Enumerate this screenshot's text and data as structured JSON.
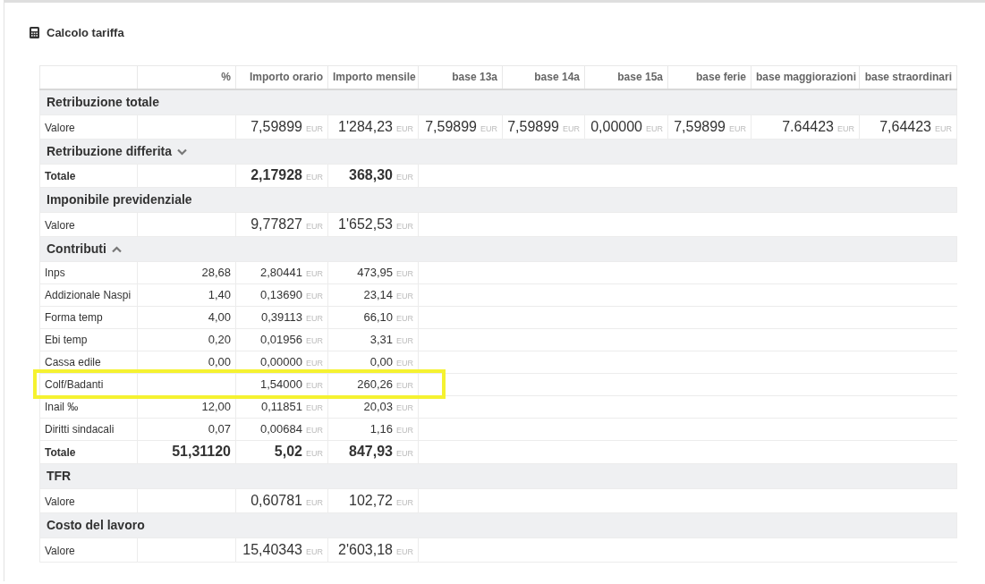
{
  "title": "Calcolo tariffa",
  "columns": [
    "",
    "%",
    "Importo orario",
    "Importo mensile",
    "base 13a",
    "base 14a",
    "base 15a",
    "base ferie",
    "base maggiorazioni",
    "base straordinari"
  ],
  "sections": [
    {
      "title": "Retribuzione totale",
      "rows": [
        {
          "kind": "value",
          "label": "Valore",
          "percent": "",
          "amounts": [
            {
              "value": "7,59899",
              "unit": "EUR"
            },
            {
              "value": "1'284,23",
              "unit": "EUR"
            },
            {
              "value": "7,59899",
              "unit": "EUR"
            },
            {
              "value": "7,59899",
              "unit": "EUR"
            },
            {
              "value": "0,00000",
              "unit": "EUR"
            },
            {
              "value": "7,59899",
              "unit": "EUR"
            },
            {
              "value": "7.64423",
              "unit": "EUR"
            },
            {
              "value": "7,64423",
              "unit": "EUR"
            }
          ]
        }
      ]
    },
    {
      "title": "Retribuzione differita",
      "expanded": false,
      "rows": [
        {
          "kind": "total",
          "label": "Totale",
          "percent": "",
          "amounts": [
            {
              "value": "2,17928",
              "unit": "EUR"
            },
            {
              "value": "368,30",
              "unit": "EUR"
            }
          ]
        }
      ]
    },
    {
      "title": "Imponibile previdenziale",
      "rows": [
        {
          "kind": "value",
          "label": "Valore",
          "percent": "",
          "amounts": [
            {
              "value": "9,77827",
              "unit": "EUR"
            },
            {
              "value": "1'652,53",
              "unit": "EUR"
            }
          ]
        }
      ]
    },
    {
      "title": "Contributi",
      "expanded": true,
      "rows": [
        {
          "kind": "detail",
          "label": "Inps",
          "percent": "28,68",
          "amounts": [
            {
              "value": "2,80441",
              "unit": "EUR"
            },
            {
              "value": "473,95",
              "unit": "EUR"
            }
          ]
        },
        {
          "kind": "detail",
          "label": "Addizionale Naspi",
          "percent": "1,40",
          "amounts": [
            {
              "value": "0,13690",
              "unit": "EUR"
            },
            {
              "value": "23,14",
              "unit": "EUR"
            }
          ]
        },
        {
          "kind": "detail",
          "label": "Forma temp",
          "percent": "4,00",
          "amounts": [
            {
              "value": "0,39113",
              "unit": "EUR"
            },
            {
              "value": "66,10",
              "unit": "EUR"
            }
          ]
        },
        {
          "kind": "detail",
          "label": "Ebi temp",
          "percent": "0,20",
          "amounts": [
            {
              "value": "0,01956",
              "unit": "EUR"
            },
            {
              "value": "3,31",
              "unit": "EUR"
            }
          ]
        },
        {
          "kind": "detail",
          "label": "Cassa edile",
          "percent": "0,00",
          "amounts": [
            {
              "value": "0,00000",
              "unit": "EUR"
            },
            {
              "value": "0,00",
              "unit": "EUR"
            }
          ]
        },
        {
          "kind": "detail",
          "label": "Colf/Badanti",
          "percent": "",
          "highlighted": true,
          "amounts": [
            {
              "value": "1,54000",
              "unit": "EUR"
            },
            {
              "value": "260,26",
              "unit": "EUR"
            }
          ]
        },
        {
          "kind": "detail",
          "label": "Inail ‰",
          "percent": "12,00",
          "amounts": [
            {
              "value": "0,11851",
              "unit": "EUR"
            },
            {
              "value": "20,03",
              "unit": "EUR"
            }
          ]
        },
        {
          "kind": "detail",
          "label": "Diritti sindacali",
          "percent": "0,07",
          "amounts": [
            {
              "value": "0,00684",
              "unit": "EUR"
            },
            {
              "value": "1,16",
              "unit": "EUR"
            }
          ]
        },
        {
          "kind": "total",
          "label": "Totale",
          "percent": "51,31120",
          "amounts": [
            {
              "value": "5,02",
              "unit": "EUR"
            },
            {
              "value": "847,93",
              "unit": "EUR"
            }
          ]
        }
      ]
    },
    {
      "title": "TFR",
      "rows": [
        {
          "kind": "value",
          "label": "Valore",
          "percent": "",
          "amounts": [
            {
              "value": "0,60781",
              "unit": "EUR"
            },
            {
              "value": "102,72",
              "unit": "EUR"
            }
          ]
        }
      ]
    },
    {
      "title": "Costo del lavoro",
      "rows": [
        {
          "kind": "value",
          "label": "Valore",
          "percent": "",
          "amounts": [
            {
              "value": "15,40343",
              "unit": "EUR"
            },
            {
              "value": "2'603,18",
              "unit": "EUR"
            }
          ]
        }
      ]
    }
  ]
}
